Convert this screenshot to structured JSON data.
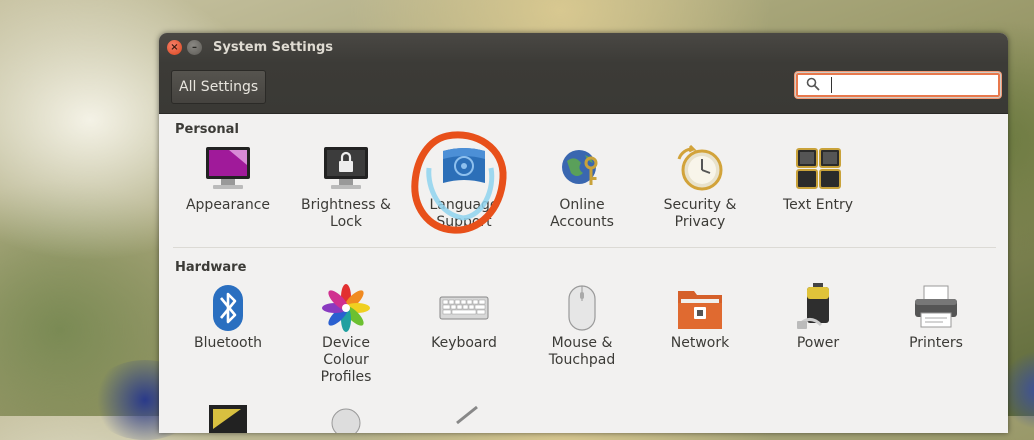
{
  "window": {
    "title": "System Settings"
  },
  "toolbar": {
    "all_settings_label": "All Settings",
    "search_value": ""
  },
  "sections": {
    "personal": {
      "title": "Personal",
      "items": [
        {
          "label": "Appearance",
          "icon": "appearance-icon"
        },
        {
          "label": "Brightness &\nLock",
          "icon": "brightness-lock-icon"
        },
        {
          "label": "Language\nSupport",
          "icon": "language-support-icon"
        },
        {
          "label": "Online\nAccounts",
          "icon": "online-accounts-icon"
        },
        {
          "label": "Security &\nPrivacy",
          "icon": "security-privacy-icon"
        },
        {
          "label": "Text Entry",
          "icon": "text-entry-icon"
        }
      ]
    },
    "hardware": {
      "title": "Hardware",
      "items": [
        {
          "label": "Bluetooth",
          "icon": "bluetooth-icon"
        },
        {
          "label": "Device\nColour\nProfiles",
          "icon": "color-profiles-icon"
        },
        {
          "label": "Keyboard",
          "icon": "keyboard-icon"
        },
        {
          "label": "Mouse &\nTouchpad",
          "icon": "mouse-icon"
        },
        {
          "label": "Network",
          "icon": "network-icon"
        },
        {
          "label": "Power",
          "icon": "power-icon"
        },
        {
          "label": "Printers",
          "icon": "printer-icon"
        }
      ]
    }
  },
  "colors": {
    "annotation": "#e8501a",
    "accent": "#dd4814"
  }
}
